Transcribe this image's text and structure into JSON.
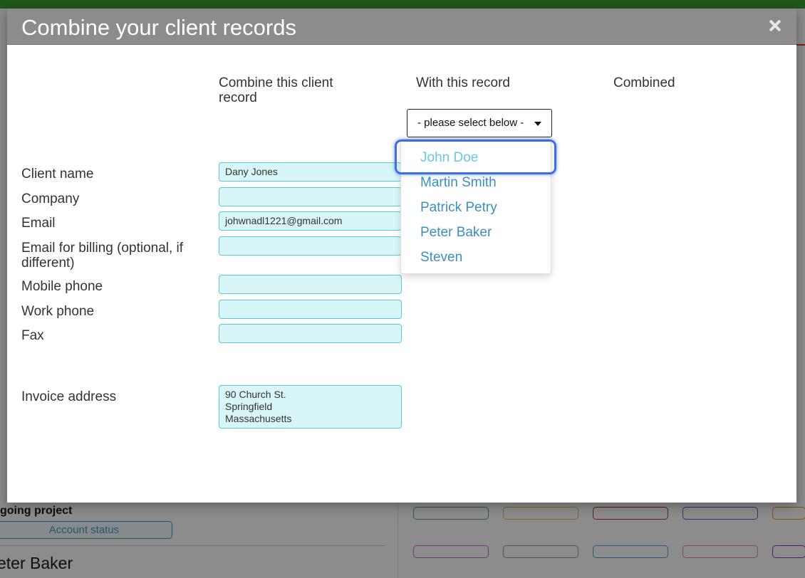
{
  "background": {
    "status_button_label": "Account status",
    "ongoing_label": "going project",
    "person_name": "eter Baker"
  },
  "modal": {
    "title": "Combine your client records",
    "columns": {
      "source": "Combine this client record",
      "target": "With this record",
      "result": "Combined"
    },
    "select": {
      "placeholder": "- please select below -",
      "options": [
        "John Doe",
        "Martin Smith",
        "Patrick Petry",
        "Peter Baker",
        "Steven"
      ],
      "highlighted_index": 0
    },
    "rows": [
      {
        "label": "Client name",
        "value": "Dany Jones"
      },
      {
        "label": "Company",
        "value": ""
      },
      {
        "label": "Email",
        "value": "johwnadl1221@gmail.com"
      },
      {
        "label": "Email for billing (optional, if different)",
        "value": ""
      },
      {
        "label": "Mobile phone",
        "value": ""
      },
      {
        "label": "Work phone",
        "value": ""
      },
      {
        "label": "Fax",
        "value": ""
      }
    ],
    "address": {
      "label": "Invoice address",
      "lines": [
        "90 Church St.",
        "Springfield",
        "Massachusetts"
      ]
    }
  },
  "colors": {
    "field_bg": "#d8f6f8",
    "field_border": "#57c9d6",
    "dropdown_link": "#3a8fbd",
    "highlight_ring": "#3d6fe0",
    "header_bg": "#8c8c8c"
  }
}
